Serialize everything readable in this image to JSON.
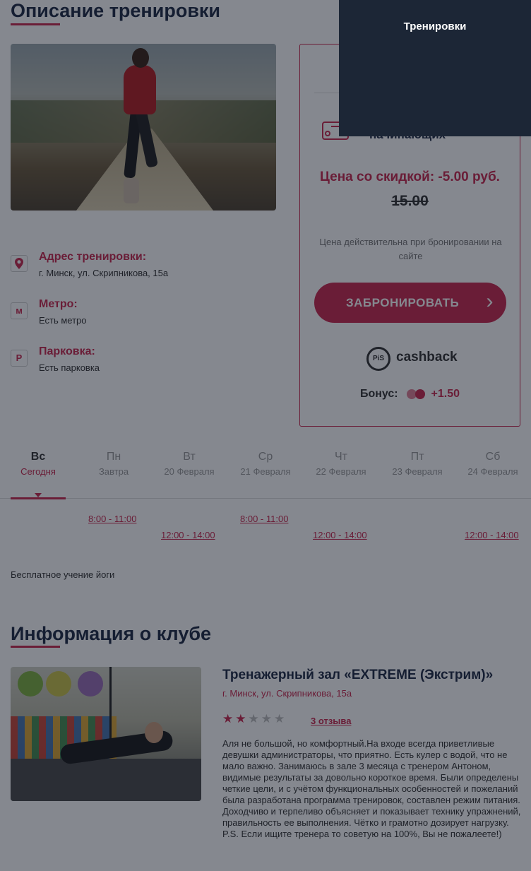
{
  "section_training": {
    "title": "Описание тренировки"
  },
  "address": {
    "label": "Адрес тренировки:",
    "value": "г. Минск, ул. Скрипникова, 15а",
    "icon": "location-pin-icon"
  },
  "metro": {
    "label": "Метро:",
    "value": "Есть метро",
    "icon_glyph": "м"
  },
  "parking": {
    "label": "Парковка:",
    "value": "Есть парковка",
    "icon_glyph": "P"
  },
  "price_card": {
    "level_text": "начинающих",
    "discount_price": "Цена со скидкой: -5.00 руб.",
    "old_price": "15.00",
    "note": "Цена действительна при бронировании на сайте",
    "book_button": "ЗАБРОНИРОВАТЬ",
    "cashback_logo_text": "cashback",
    "cashback_logo_badge": "PiS",
    "bonus_label": "Бонус:",
    "bonus_value": "+1.50"
  },
  "schedule": {
    "days": [
      {
        "name": "Вс",
        "date": "Сегодня",
        "active": true
      },
      {
        "name": "Пн",
        "date": "Завтра",
        "active": false
      },
      {
        "name": "Вт",
        "date": "20 Февраля",
        "active": false
      },
      {
        "name": "Ср",
        "date": "21 Февраля",
        "active": false
      },
      {
        "name": "Чт",
        "date": "22 Февраля",
        "active": false
      },
      {
        "name": "Пт",
        "date": "23 Февраля",
        "active": false
      },
      {
        "name": "Сб",
        "date": "24 Февраля",
        "active": false
      }
    ],
    "slots": {
      "mon_morning": "8:00 - 11:00",
      "tue_afternoon": "12:00 - 14:00",
      "wed_morning": "8:00 - 11:00",
      "thu_afternoon": "12:00 - 14:00",
      "sat_afternoon": "12:00 - 14:00"
    }
  },
  "training_description": "Бесплатное учение йоги",
  "section_club": {
    "title": "Информация о клубе"
  },
  "club": {
    "name": "Тренажерный зал «EXTREME (Экстрим)»",
    "address": "г. Минск, ул. Скрипникова, 15а",
    "rating": 2,
    "rating_max": 5,
    "reviews": "3 отзыва",
    "review_text": "Аля не большой, но комфортный.На входе всегда приветливые девушки администраторы, что приятно. Есть кулер с водой, что не мало важно. Занимаюсь в зале 3 месяца с тренером Антоном, видимые результаты за довольно короткое время. Были определены четкие цели, и с учётом функциональных особенностей и пожеланий была разработана программа тренировок, составлен режим питания. Доходчиво и терпеливо объясняет и показывает технику упражнений, правильность ее выполнения. Чётко и грамотно дозирует нагрузку. P.S. Если ищите тренера то советую на 100%, Вы не пожалеете!)"
  },
  "nav_menu": {
    "title": "Тренировки"
  },
  "colors": {
    "accent": "#c8294f",
    "heading": "#1f2a44",
    "nav_bg": "#1c2636"
  }
}
